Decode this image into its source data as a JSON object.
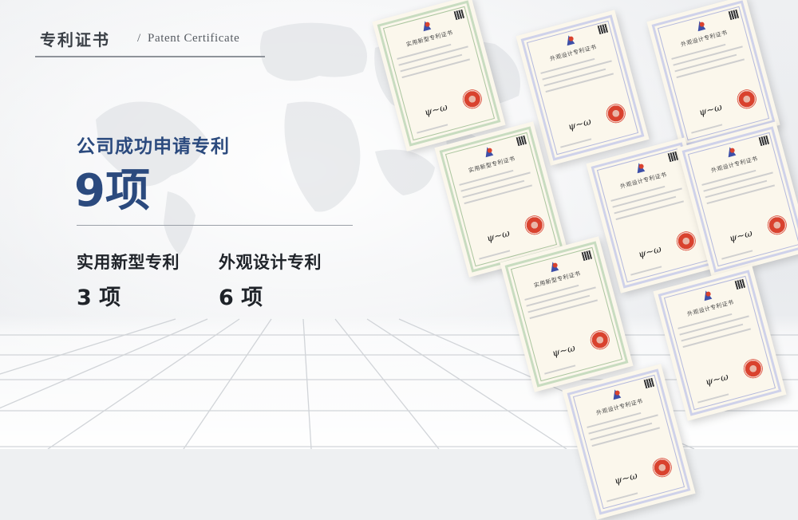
{
  "header": {
    "title_cn": "专利证书",
    "separator": "/",
    "title_en": "Patent Certificate"
  },
  "summary": {
    "headline": "公司成功申请专利",
    "total": "9项"
  },
  "stats": [
    {
      "label": "实用新型专利",
      "value": "3 项"
    },
    {
      "label": "外观设计专利",
      "value": "6 项"
    }
  ],
  "certificates": [
    {
      "kind": "utility",
      "title": "实用新型专利证书"
    },
    {
      "kind": "utility",
      "title": "实用新型专利证书"
    },
    {
      "kind": "utility",
      "title": "实用新型专利证书"
    },
    {
      "kind": "design",
      "title": "外观设计专利证书"
    },
    {
      "kind": "design",
      "title": "外观设计专利证书"
    },
    {
      "kind": "design",
      "title": "外观设计专利证书"
    },
    {
      "kind": "design",
      "title": "外观设计专利证书"
    },
    {
      "kind": "design",
      "title": "外观设计专利证书"
    },
    {
      "kind": "design",
      "title": "外观设计专利证书"
    }
  ],
  "colors": {
    "accent": "#2b4a7e",
    "text": "#1f2329",
    "header_text": "#3a3f46",
    "seal": "#d9422e"
  }
}
